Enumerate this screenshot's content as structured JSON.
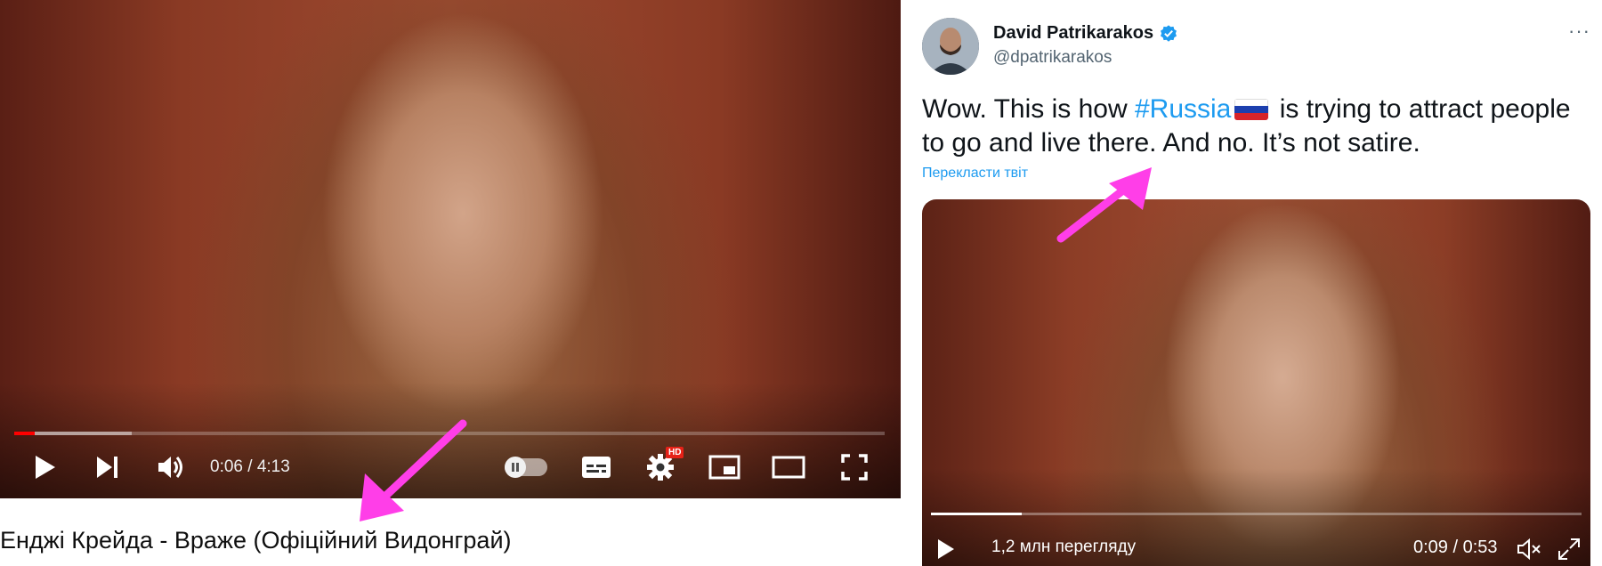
{
  "youtube": {
    "player": {
      "current_time": "0:06",
      "duration": "4:13",
      "time_display": "0:06 / 4:13",
      "played_fraction": 0.024,
      "buffered_fraction": 0.135,
      "hd_badge": "HD",
      "progress_color": "#ff0000"
    },
    "video_title": "Енджі Крейда - Враже (Офіційний Видонграй)"
  },
  "tweet": {
    "author_name": "David Patrikarakos",
    "author_handle": "@dpatrikarakos",
    "more": "···",
    "text_before": "Wow. This is how ",
    "hashtag": "#Russia",
    "text_after": " is trying to attract people to go and live there. And no. It’s not satire.",
    "translate_link": "Перекласти твіт",
    "video": {
      "views": "1,2 млн перегляду",
      "time_display": "0:09 / 0:53",
      "progress_fraction": 0.14
    },
    "colors": {
      "link": "#1d9bf0",
      "verified": "#1d9bf0"
    }
  },
  "annotations": {
    "arrow_color": "#ff3ee8"
  }
}
